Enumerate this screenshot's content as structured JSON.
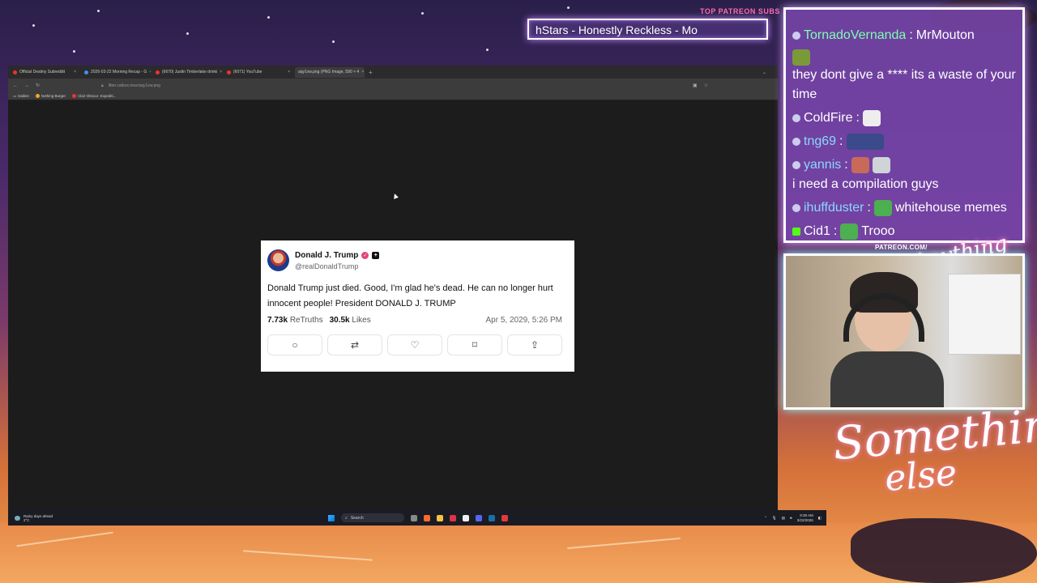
{
  "overlay": {
    "subs_title": "TOP PATREON SUBS",
    "subs_ticker": "hStars - Honestly Reckless - Mo",
    "patreon_tag": "PATREON.COM/",
    "signature": "Anything else",
    "logo_line1": "Something",
    "logo_line2": "else"
  },
  "browser": {
    "tabs": [
      {
        "label": "Official Destiny Subreddit"
      },
      {
        "label": "2026-03-22 Morning Recap - G"
      },
      {
        "label": "(6670) Justin Timberlake drinki"
      },
      {
        "label": "(6071) YouTube"
      },
      {
        "label": "aqy1xw.png (PNG Image, 590 × 4"
      }
    ],
    "url": "litter.catbox.moe/aqy1xw.png",
    "bookmarks": [
      "Dailies",
      "Nothing Burger",
      "Clair Obscur: Expediti..."
    ]
  },
  "post": {
    "name": "Donald J. Trump",
    "handle": "@realDonaldTrump",
    "text": "Donald Trump just died. Good, I'm glad he's dead. He can no longer hurt innocent people! President DONALD J. TRUMP",
    "retruths_count": "7.73k",
    "retruths_label": "ReTruths",
    "likes_count": "30.5k",
    "likes_label": "Likes",
    "date": "Apr 5, 2029, 5:26 PM"
  },
  "taskbar": {
    "weather_line1": "Rainy days ahead",
    "weather_line2": "2°C",
    "search_placeholder": "Search",
    "time": "9:39 AM",
    "date": "3/22/2026"
  },
  "chat": {
    "messages": [
      {
        "user": "TornadoVernanda",
        "user_color": "#7dffb0",
        "text": "MrMouton"
      },
      {
        "user": "",
        "user_color": "#ffffff",
        "text": "they dont give a **** its a waste of your time"
      },
      {
        "user": "ColdFire",
        "user_color": "#ffffff",
        "text": ""
      },
      {
        "user": "tng69",
        "user_color": "#8ad8ff",
        "text": ""
      },
      {
        "user": "yannis",
        "user_color": "#8ad8ff",
        "text": "i need a compilation guys"
      },
      {
        "user": "ihuffduster",
        "user_color": "#8ad8ff",
        "text": "whitehouse memes"
      },
      {
        "user": "Cid1",
        "user_color": "#ffffff",
        "text": "Trooo"
      }
    ]
  }
}
